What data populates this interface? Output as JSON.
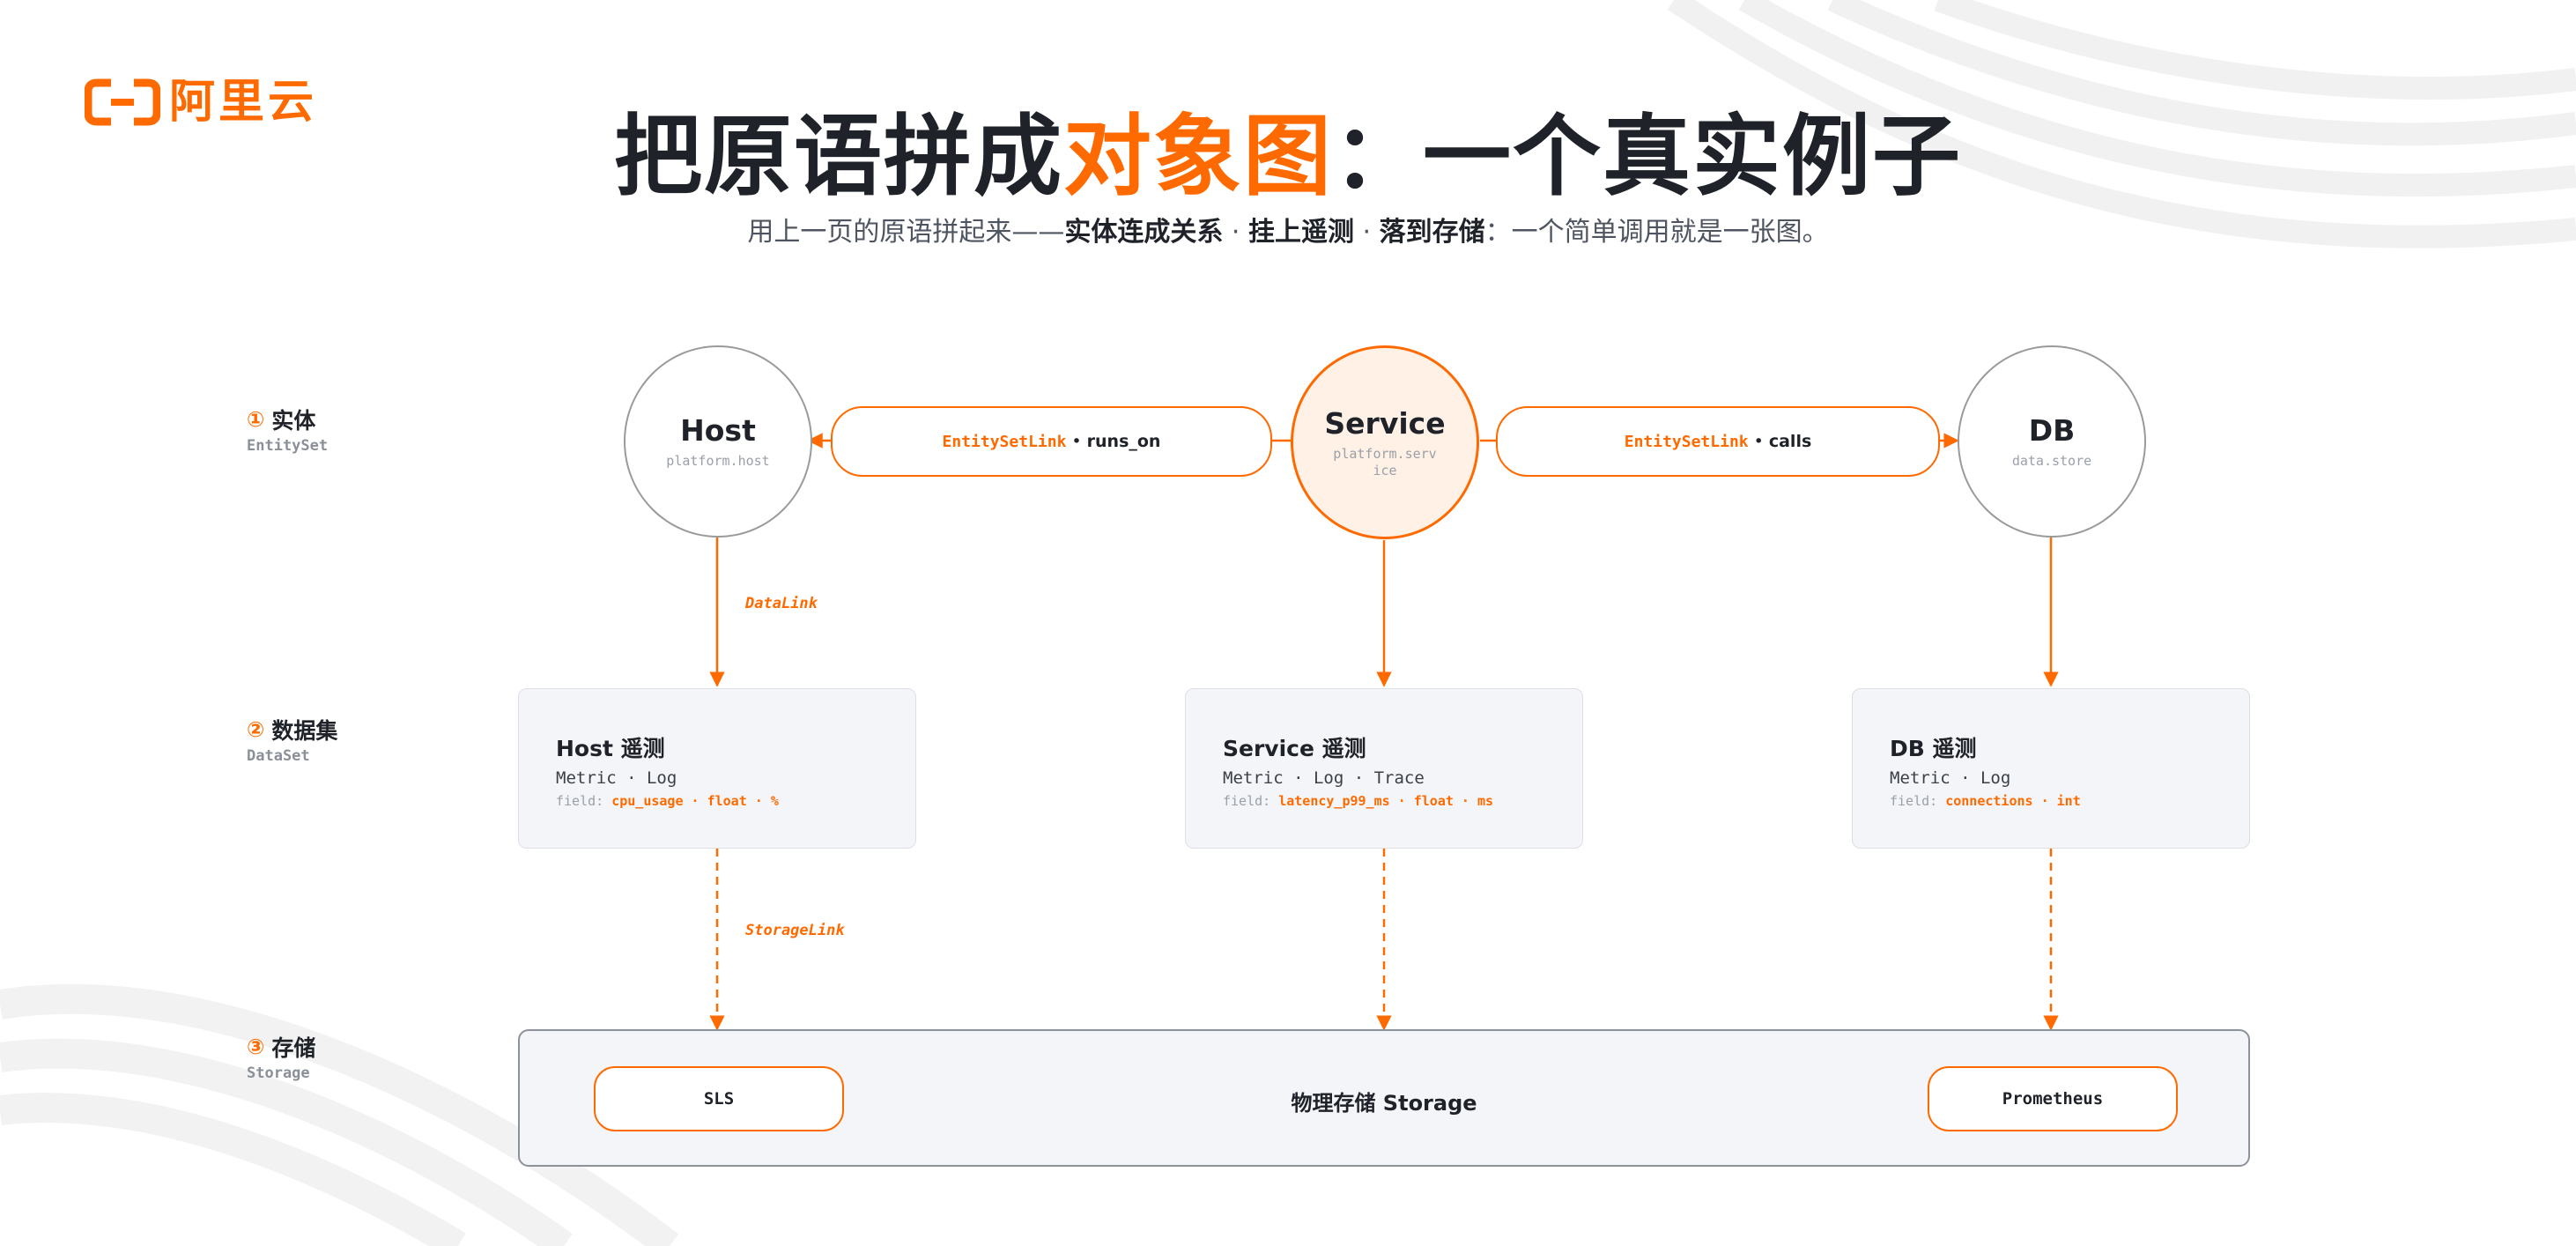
{
  "logo": {
    "text": "阿里云"
  },
  "title": {
    "part1": "把原语拼成",
    "highlight": "对象图",
    "part2": "：一个真实例子"
  },
  "subtitle": {
    "prefix": "用上一页的原语拼起来——",
    "b1": "实体连成关系",
    "sep1": " · ",
    "b2": "挂上遥测",
    "sep2": " · ",
    "b3": "落到存储",
    "suffix": "：一个简单调用就是一张图。"
  },
  "rows": [
    {
      "num": "①",
      "title": "实体",
      "sub": "EntitySet"
    },
    {
      "num": "②",
      "title": "数据集",
      "sub": "DataSet"
    },
    {
      "num": "③",
      "title": "存储",
      "sub": "Storage"
    }
  ],
  "entities": {
    "host": {
      "name": "Host",
      "id": "platform.host"
    },
    "service": {
      "name": "Service",
      "id": "platform.service"
    },
    "db": {
      "name": "DB",
      "id": "data.store"
    }
  },
  "relations": [
    {
      "kind": "EntitySetLink",
      "sep": "•",
      "name": "runs_on"
    },
    {
      "kind": "EntitySetLink",
      "sep": "•",
      "name": "calls"
    }
  ],
  "link_labels": {
    "data": "DataLink",
    "storage": "StorageLink"
  },
  "datasets": [
    {
      "title": "Host 遥测",
      "types": "Metric · Log",
      "field_label": "field:",
      "field": "cpu_usage · float · %"
    },
    {
      "title": "Service 遥测",
      "types": "Metric · Log · Trace",
      "field_label": "field:",
      "field": "latency_p99_ms · float · ms"
    },
    {
      "title": "DB 遥测",
      "types": "Metric · Log",
      "field_label": "field:",
      "field": "connections · int"
    }
  ],
  "storage": {
    "center": "物理存储 Storage",
    "left": "SLS",
    "right": "Prometheus"
  },
  "colors": {
    "accent": "#ff6a00",
    "text": "#1f2329",
    "card_bg": "#f4f5f8",
    "service_fill": "#fff1e6"
  }
}
